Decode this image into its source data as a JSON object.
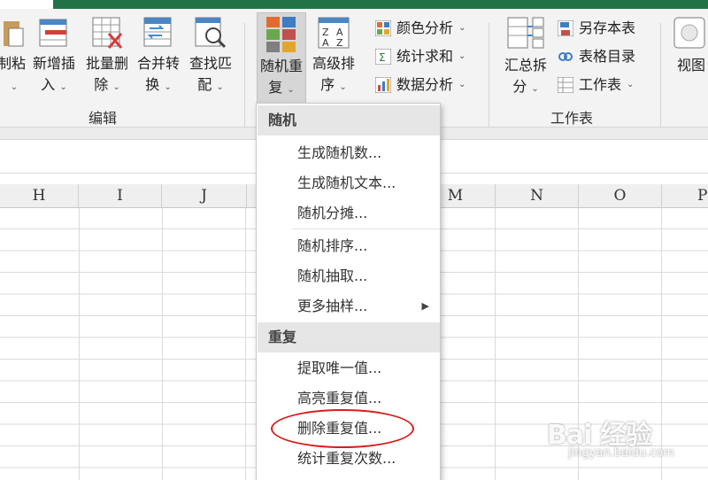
{
  "colors": {
    "excel_green": "#217346",
    "highlight_circle": "#d81e1e"
  },
  "ribbon": {
    "buttons": [
      {
        "id": "copy-paste",
        "line1": "制粘",
        "line2": ""
      },
      {
        "id": "add-insert",
        "line1": "新增插",
        "line2": "入"
      },
      {
        "id": "batch-delete",
        "line1": "批量删",
        "line2": "除"
      },
      {
        "id": "merge-convert",
        "line1": "合并转",
        "line2": "换"
      },
      {
        "id": "find-match",
        "line1": "查找匹",
        "line2": "配"
      },
      {
        "id": "random-dup",
        "line1": "随机重",
        "line2": "复"
      },
      {
        "id": "advanced-sort",
        "line1": "高级排",
        "line2": "序"
      },
      {
        "id": "summary-split",
        "line1": "汇总拆",
        "line2": "分"
      },
      {
        "id": "view",
        "line1": "视图",
        "line2": ""
      }
    ],
    "small": [
      {
        "label": "颜色分析"
      },
      {
        "label": "统计求和"
      },
      {
        "label": "数据分析"
      },
      {
        "label": "另存本表"
      },
      {
        "label": "表格目录"
      },
      {
        "label": "工作表"
      }
    ],
    "group_labels": {
      "edit": "编辑",
      "worksheet": "工作表"
    }
  },
  "columns": [
    "H",
    "I",
    "J",
    "M",
    "N",
    "O",
    "P"
  ],
  "menu": {
    "section1": "随机",
    "items1": [
      "生成随机数...",
      "生成随机文本...",
      "随机分摊..."
    ],
    "items2": [
      "随机排序...",
      "随机抽取...",
      "更多抽样..."
    ],
    "section2": "重复",
    "items3": [
      "提取唯一值...",
      "高亮重复值...",
      "删除重复值...",
      "统计重复次数..."
    ]
  },
  "watermark": {
    "main": "Bai 经验",
    "sub": "jingyan.baidu.com"
  }
}
